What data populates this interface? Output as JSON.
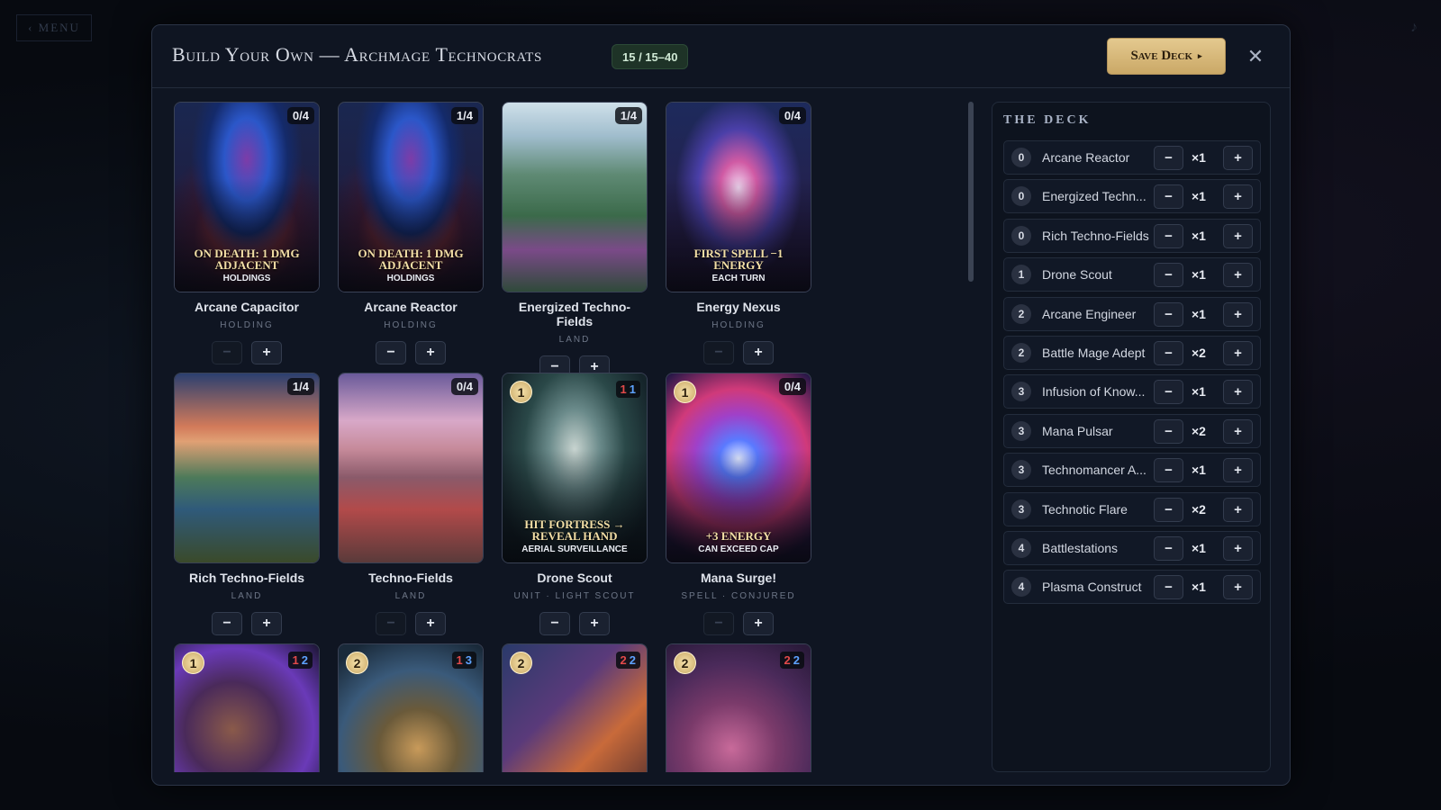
{
  "background": {
    "menu_label": "‹ MENU",
    "music_icon": "music-note-icon"
  },
  "header": {
    "title": "Build Your Own — Archmage Technocrats",
    "count": "15 / 15–40",
    "save_label": "Save Deck",
    "save_arrow": "▸",
    "close_glyph": "✕"
  },
  "colors": {
    "accent_gold": "#d8bb7a",
    "attack": "#e24a4a",
    "health": "#5ea2ff"
  },
  "cards": [
    {
      "name": "Arcane Capacitor",
      "type": "HOLDING",
      "owned": "0/4",
      "effect": "On death: 1 dmg adjacent",
      "sub": "Holdings",
      "minus_enabled": false
    },
    {
      "name": "Arcane Reactor",
      "type": "HOLDING",
      "owned": "1/4",
      "effect": "On death: 1 dmg adjacent",
      "sub": "Holdings",
      "minus_enabled": true
    },
    {
      "name": "Energized Techno-Fields",
      "type": "LAND",
      "owned": "1/4",
      "effect": "",
      "sub": "",
      "minus_enabled": true
    },
    {
      "name": "Energy Nexus",
      "type": "HOLDING",
      "owned": "0/4",
      "effect": "First spell −1 energy",
      "sub": "Each turn",
      "minus_enabled": false
    },
    {
      "name": "Rich Techno-Fields",
      "type": "LAND",
      "owned": "1/4",
      "effect": "",
      "sub": "",
      "minus_enabled": true
    },
    {
      "name": "Techno-Fields",
      "type": "LAND",
      "owned": "0/4",
      "effect": "",
      "sub": "",
      "minus_enabled": false
    },
    {
      "name": "Drone Scout",
      "type": "UNIT · LIGHT SCOUT",
      "cost": "1",
      "atk": "1",
      "hp": "1",
      "effect": "Hit fortress → reveal hand",
      "sub": "Aerial surveillance",
      "minus_enabled": true
    },
    {
      "name": "Mana Surge!",
      "type": "SPELL · CONJURED",
      "cost": "1",
      "owned": "0/4",
      "effect": "+3 Energy",
      "sub": "Can exceed cap",
      "minus_enabled": false
    },
    {
      "name": "",
      "type": "",
      "cost": "1",
      "atk": "1",
      "hp": "2"
    },
    {
      "name": "",
      "type": "",
      "cost": "2",
      "atk": "1",
      "hp": "3"
    },
    {
      "name": "",
      "type": "",
      "cost": "2",
      "atk": "2",
      "hp": "2"
    },
    {
      "name": "",
      "type": "",
      "cost": "2",
      "atk": "2",
      "hp": "2"
    }
  ],
  "deck": {
    "title": "THE DECK",
    "rows": [
      {
        "cost": "0",
        "name": "Arcane Reactor",
        "count": "×1"
      },
      {
        "cost": "0",
        "name": "Energized Techn...",
        "count": "×1"
      },
      {
        "cost": "0",
        "name": "Rich Techno-Fields",
        "count": "×1"
      },
      {
        "cost": "1",
        "name": "Drone Scout",
        "count": "×1"
      },
      {
        "cost": "2",
        "name": "Arcane Engineer",
        "count": "×1"
      },
      {
        "cost": "2",
        "name": "Battle Mage Adept",
        "count": "×2"
      },
      {
        "cost": "3",
        "name": "Infusion of Know...",
        "count": "×1"
      },
      {
        "cost": "3",
        "name": "Mana Pulsar",
        "count": "×2"
      },
      {
        "cost": "3",
        "name": "Technomancer A...",
        "count": "×1"
      },
      {
        "cost": "3",
        "name": "Technotic Flare",
        "count": "×2"
      },
      {
        "cost": "4",
        "name": "Battlestations",
        "count": "×1"
      },
      {
        "cost": "4",
        "name": "Plasma Construct",
        "count": "×1"
      }
    ]
  }
}
